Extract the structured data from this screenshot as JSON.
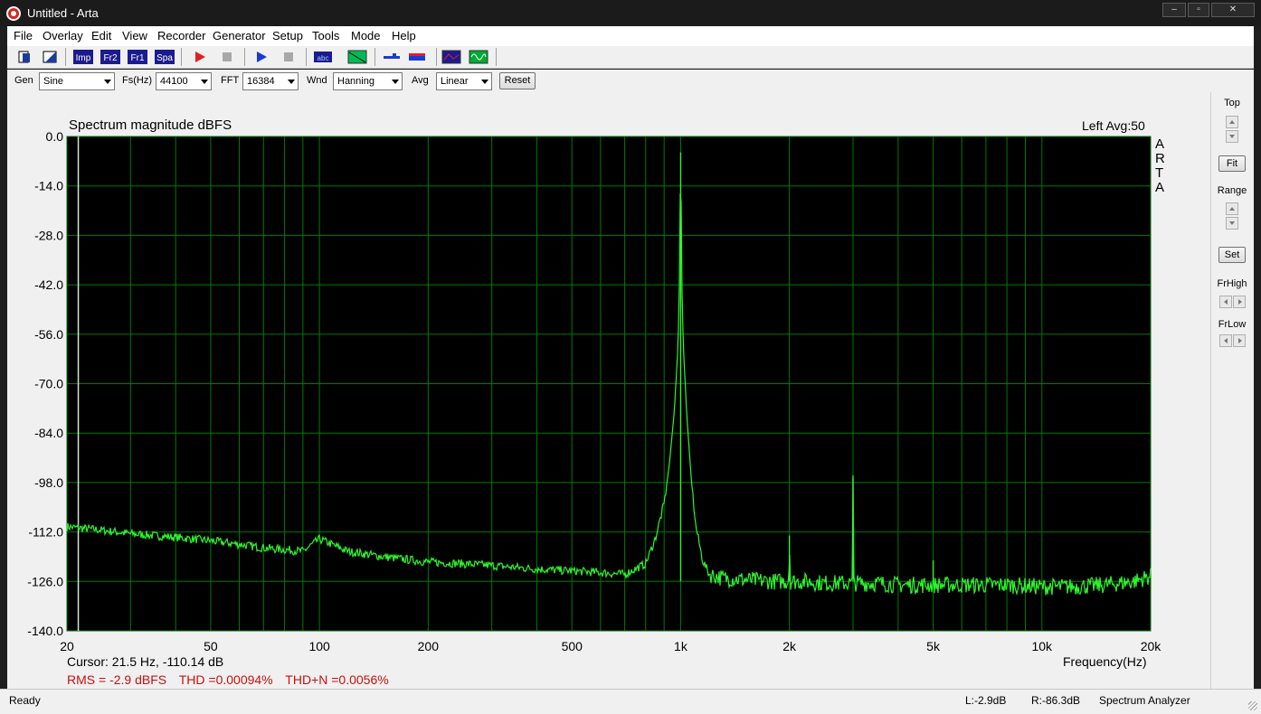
{
  "window": {
    "title": "Untitled - Arta",
    "controls": [
      "‒",
      "▫",
      "✕"
    ]
  },
  "menu": [
    "File",
    "Overlay",
    "Edit",
    "View",
    "Recorder",
    "Generator",
    "Setup",
    "Tools",
    "Mode",
    "Help"
  ],
  "toolbar": {
    "buttons": [
      {
        "name": "new-icon",
        "label": ""
      },
      {
        "name": "open-icon",
        "label": ""
      },
      {
        "name": "impulse-mode-button",
        "label": "Imp"
      },
      {
        "name": "freq-response-2ch-button",
        "label": "Fr2"
      },
      {
        "name": "freq-response-1ch-button",
        "label": "Fr1"
      },
      {
        "name": "spectrum-analyzer-button",
        "label": "Spa"
      },
      {
        "name": "record-icon",
        "label": ""
      },
      {
        "name": "stop-icon",
        "label": ""
      },
      {
        "name": "play-icon",
        "label": ""
      },
      {
        "name": "stop-gen-icon",
        "label": ""
      },
      {
        "name": "abc-icon",
        "label": ""
      },
      {
        "name": "chart-icon",
        "label": ""
      },
      {
        "name": "meter-icon",
        "label": ""
      },
      {
        "name": "level-icon",
        "label": ""
      },
      {
        "name": "scope-icon",
        "label": ""
      },
      {
        "name": "waveform-icon",
        "label": ""
      }
    ]
  },
  "options": {
    "gen_label": "Gen",
    "gen_value": "Sine",
    "fs_label": "Fs(Hz)",
    "fs_value": "44100",
    "fft_label": "FFT",
    "fft_value": "16384",
    "wnd_label": "Wnd",
    "wnd_value": "Hanning",
    "avg_label": "Avg",
    "avg_value": "Linear",
    "reset_label": "Reset"
  },
  "right_panel": {
    "top_label": "Top",
    "fit_label": "Fit",
    "range_label": "Range",
    "set_label": "Set",
    "frhigh_label": "FrHigh",
    "frlow_label": "FrLow"
  },
  "chart_data": {
    "type": "line",
    "title": "Spectrum magnitude dBFS",
    "channel_avg": "Left  Avg:50",
    "side_logo": [
      "A",
      "R",
      "T",
      "A"
    ],
    "xlabel": "Frequency(Hz)",
    "ylabel": "",
    "xscale": "log",
    "xlim": [
      20,
      20000
    ],
    "ylim": [
      -140,
      0
    ],
    "xticks": [
      {
        "value": 20,
        "label": "20"
      },
      {
        "value": 50,
        "label": "50"
      },
      {
        "value": 100,
        "label": "100"
      },
      {
        "value": 200,
        "label": "200"
      },
      {
        "value": 500,
        "label": "500"
      },
      {
        "value": 1000,
        "label": "1k"
      },
      {
        "value": 2000,
        "label": "2k"
      },
      {
        "value": 5000,
        "label": "5k"
      },
      {
        "value": 10000,
        "label": "10k"
      },
      {
        "value": 20000,
        "label": "20k"
      }
    ],
    "yticks": [
      "0.0",
      "-14.0",
      "-28.0",
      "-42.0",
      "-56.0",
      "-70.0",
      "-84.0",
      "-98.0",
      "-112.0",
      "-126.0",
      "-140.0"
    ],
    "cursor_freq": 21.5,
    "colors": {
      "background": "#000000",
      "grid": "#007a00",
      "trace": "#2df52d",
      "cursor": "#cfe8cf"
    },
    "grid": true,
    "series": [
      {
        "x": [
          20,
          25,
          30,
          40,
          50,
          60,
          70,
          80,
          90,
          100,
          120,
          150,
          200,
          250,
          300,
          400,
          500,
          600,
          700,
          800,
          850,
          900,
          930,
          960,
          980,
          990,
          1000,
          1010,
          1020,
          1040,
          1070,
          1100,
          1150,
          1200,
          1300,
          1500,
          1800,
          1990,
          2000,
          2010,
          2200,
          2500,
          2990,
          3000,
          3010,
          3500,
          4000,
          4990,
          5000,
          5010,
          6000,
          8000,
          10000,
          12000,
          15000,
          18000,
          20000
        ],
        "y": [
          -110.5,
          -111.5,
          -112.5,
          -113.5,
          -114.5,
          -115.5,
          -116.5,
          -117,
          -117.5,
          -114,
          -117.5,
          -119,
          -120.5,
          -121,
          -121.5,
          -122.5,
          -123,
          -123.5,
          -124,
          -121,
          -114,
          -104,
          -93,
          -78,
          -62,
          -49,
          -4.5,
          -49,
          -62,
          -79,
          -97,
          -110,
          -120,
          -124,
          -125,
          -125.5,
          -126,
          -126,
          -113,
          -126,
          -126,
          -126.5,
          -126.5,
          -96,
          -126.5,
          -126.5,
          -127,
          -127,
          -120,
          -127,
          -127,
          -127,
          -127.5,
          -127.5,
          -127,
          -126,
          -124.5
        ]
      }
    ]
  },
  "readout": {
    "cursor": "Cursor:    21.5 Hz, -110.14 dB",
    "rms": "RMS =   -2.9 dBFS",
    "thd": "THD =0.00094%",
    "thdn": "THD+N =0.0056%"
  },
  "status": {
    "ready": "Ready",
    "left_level": "L:-2.9dB",
    "right_level": "R:-86.3dB",
    "mode": "Spectrum Analyzer"
  }
}
